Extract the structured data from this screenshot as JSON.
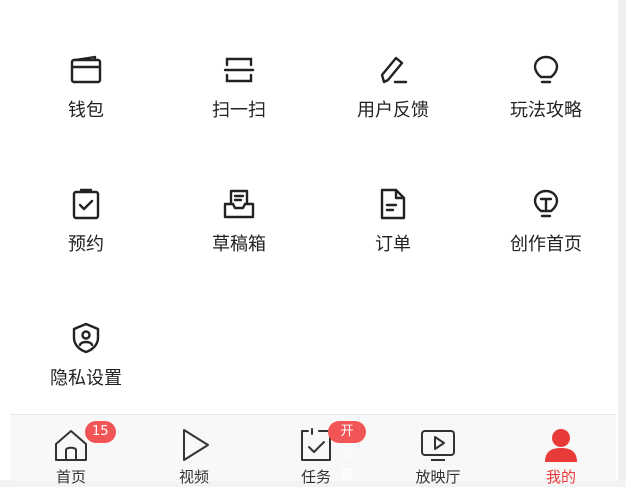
{
  "menu": {
    "items": [
      {
        "label": "钱包",
        "icon": "wallet-icon"
      },
      {
        "label": "扫一扫",
        "icon": "scan-icon"
      },
      {
        "label": "用户反馈",
        "icon": "pen-feedback-icon"
      },
      {
        "label": "玩法攻略",
        "icon": "lightbulb-icon"
      },
      {
        "label": "预约",
        "icon": "clipboard-check-icon"
      },
      {
        "label": "草稿箱",
        "icon": "inbox-drafts-icon"
      },
      {
        "label": "订单",
        "icon": "document-icon"
      },
      {
        "label": "创作首页",
        "icon": "lightbulb-creator-icon"
      },
      {
        "label": "隐私设置",
        "icon": "shield-user-icon"
      }
    ]
  },
  "tabbar": {
    "tabs": [
      {
        "label": "首页",
        "icon": "home-icon",
        "badge": "15"
      },
      {
        "label": "视频",
        "icon": "play-icon"
      },
      {
        "label": "任务",
        "icon": "task-check-icon",
        "badge": "开宝箱"
      },
      {
        "label": "放映厅",
        "icon": "tv-play-icon"
      },
      {
        "label": "我的",
        "icon": "user-icon",
        "active": true
      }
    ]
  },
  "colors": {
    "accent": "#e93a3a",
    "badge": "#f25555",
    "text": "#222222"
  }
}
